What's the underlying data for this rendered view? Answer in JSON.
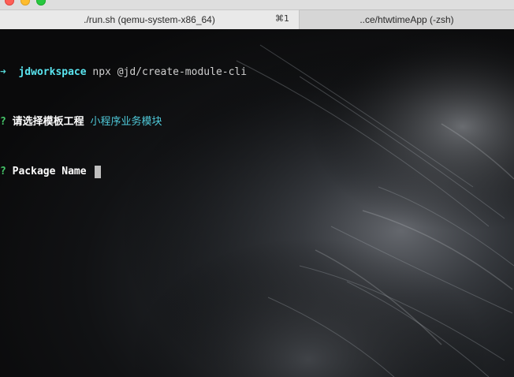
{
  "window": {
    "tabs": [
      {
        "label": "./run.sh (qemu-system-x86_64)",
        "shortcut": "⌘1",
        "active": true
      },
      {
        "label": "..ce/htwtimeApp (-zsh)",
        "active": false
      }
    ]
  },
  "terminal": {
    "line1": {
      "arrow": "➜",
      "cwd": "jdworkspace",
      "command": "npx @jd/create-module-cli"
    },
    "line2": {
      "marker": "?",
      "question": "请选择模板工程",
      "answer": "小程序业务模块"
    },
    "line3": {
      "marker": "?",
      "question": "Package Name"
    }
  },
  "colors": {
    "cwd": "#5ae4ef",
    "marker": "#46c86a",
    "answer": "#4fc9d9"
  }
}
